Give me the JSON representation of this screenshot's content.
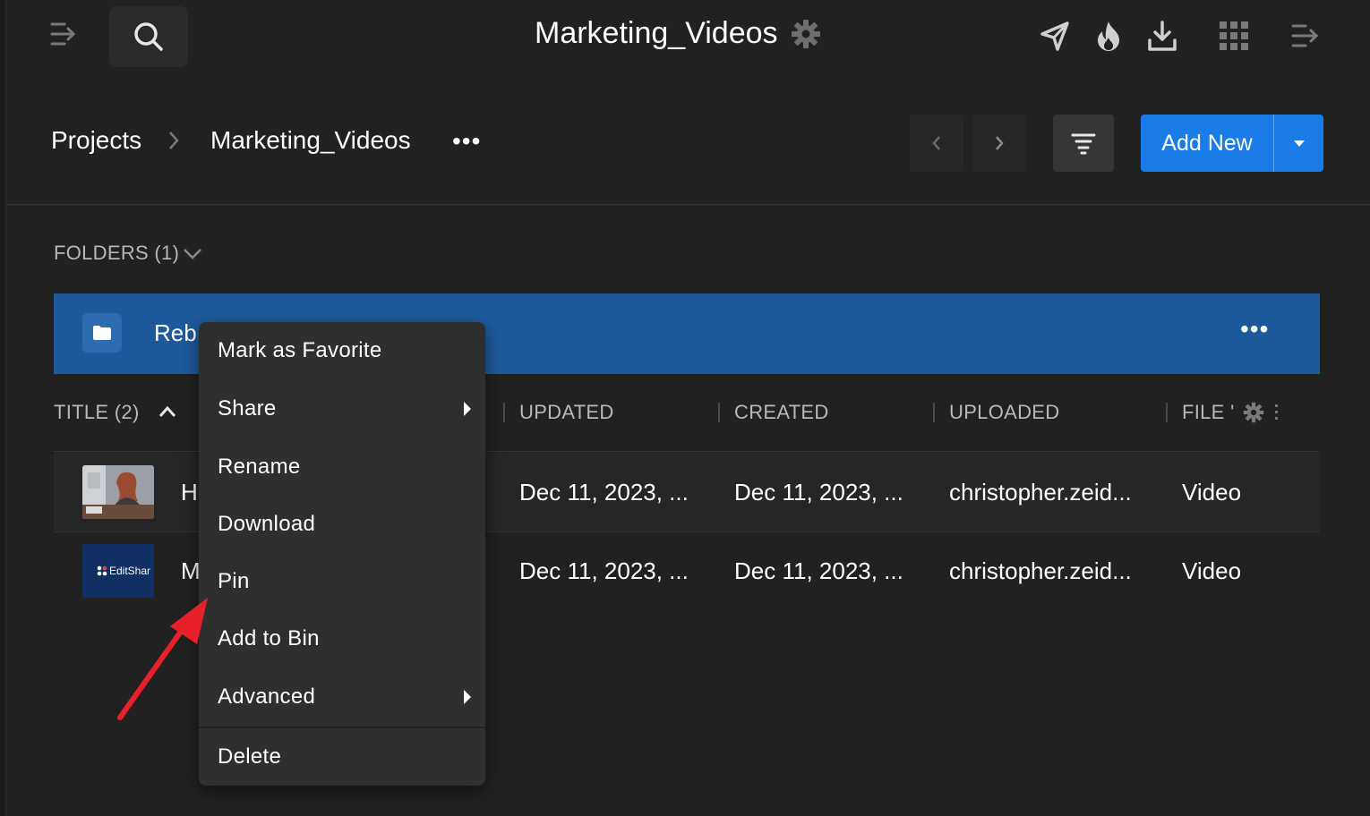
{
  "header": {
    "title": "Marketing_Videos",
    "icons": [
      "collapse-sidebar-icon",
      "search-icon",
      "settings-gear-icon",
      "send-icon",
      "fire-icon",
      "download-icon",
      "apps-grid-icon",
      "expand-panel-icon"
    ]
  },
  "breadcrumb": {
    "root": "Projects",
    "current": "Marketing_Videos",
    "more": "•••"
  },
  "toolbar": {
    "add_new_label": "Add New"
  },
  "folders": {
    "label": "FOLDERS (1)",
    "items": [
      {
        "name": "Reb",
        "more": "•••"
      }
    ]
  },
  "columns": {
    "title": "TITLE (2)",
    "updated": "UPDATED",
    "created": "CREATED",
    "uploaded": "UPLOADED",
    "file_type": "FILE '"
  },
  "files": [
    {
      "title": "H",
      "updated": "Dec 11, 2023, ...",
      "created": "Dec 11, 2023, ...",
      "uploaded": "christopher.zeid...",
      "type": "Video"
    },
    {
      "title": "M",
      "updated": "Dec 11, 2023, ...",
      "created": "Dec 11, 2023, ...",
      "uploaded": "christopher.zeid...",
      "type": "Video",
      "thumb_text_a": "EditShar"
    }
  ],
  "context_menu": {
    "items": [
      {
        "label": "Mark as Favorite",
        "submenu": false
      },
      {
        "label": "Share",
        "submenu": true
      },
      {
        "label": "Rename",
        "submenu": false
      },
      {
        "label": "Download",
        "submenu": false
      },
      {
        "label": "Pin",
        "submenu": false
      },
      {
        "label": "Add to Bin",
        "submenu": false
      },
      {
        "label": "Advanced",
        "submenu": true
      },
      {
        "label": "Delete",
        "submenu": false
      }
    ]
  },
  "colors": {
    "background": "#212121",
    "accent": "#1a7ce6",
    "selected_row": "#1d5a9c",
    "menu_bg": "#2f2f2f",
    "annotation_arrow": "#e8202a"
  }
}
